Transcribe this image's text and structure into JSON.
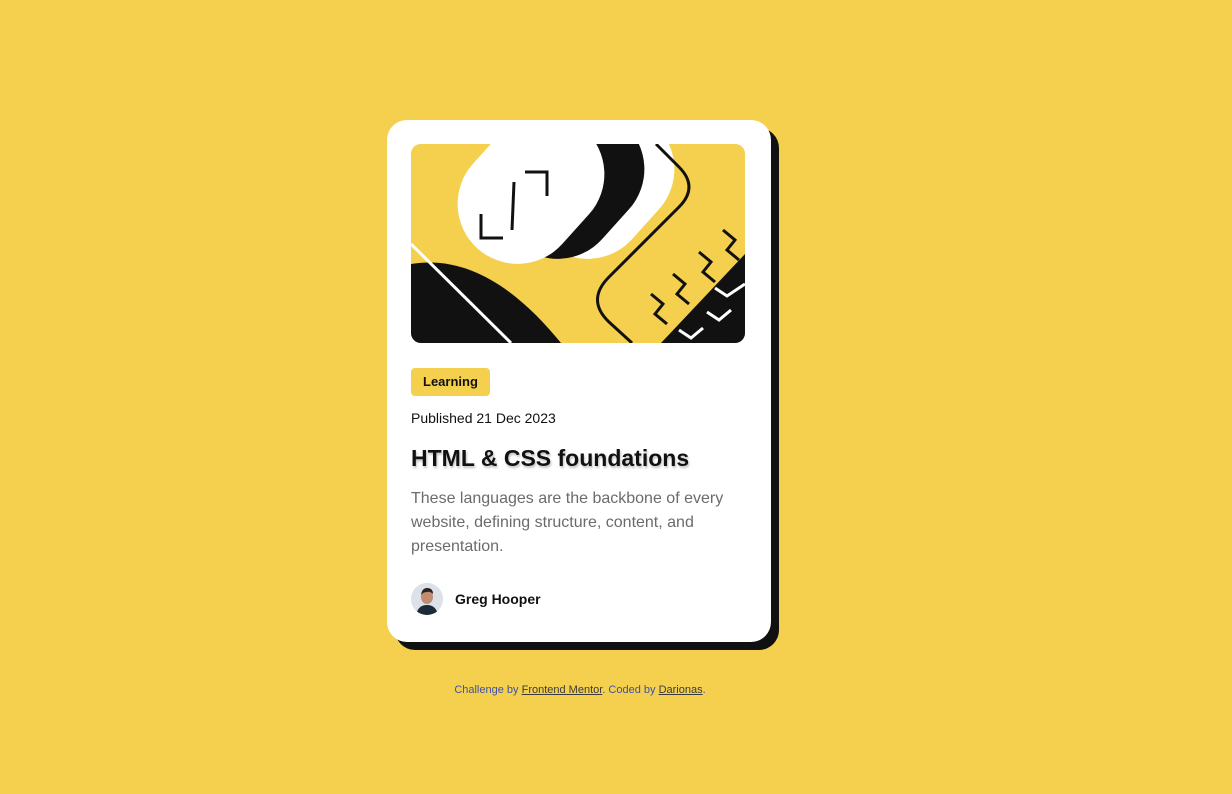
{
  "card": {
    "hero_image": "abstract-geometric-illustration",
    "tag": "Learning",
    "published_label": "Published",
    "published_date": "21 Dec 2023",
    "title": "HTML & CSS foundations",
    "description": "These languages are the backbone of every website, defining structure, content, and presentation.",
    "author": {
      "name": "Greg Hooper",
      "avatar": "avatar-icon"
    }
  },
  "attribution": {
    "prefix": "Challenge by",
    "challenge_link": "Frontend Mentor",
    "middle": ". Coded by",
    "author_link": "Darionas",
    "suffix": "."
  },
  "colors": {
    "background": "#f4d04e",
    "card": "#ffffff",
    "text": "#111111",
    "muted": "#6b6b6b",
    "link_text": "#3e52a3"
  }
}
